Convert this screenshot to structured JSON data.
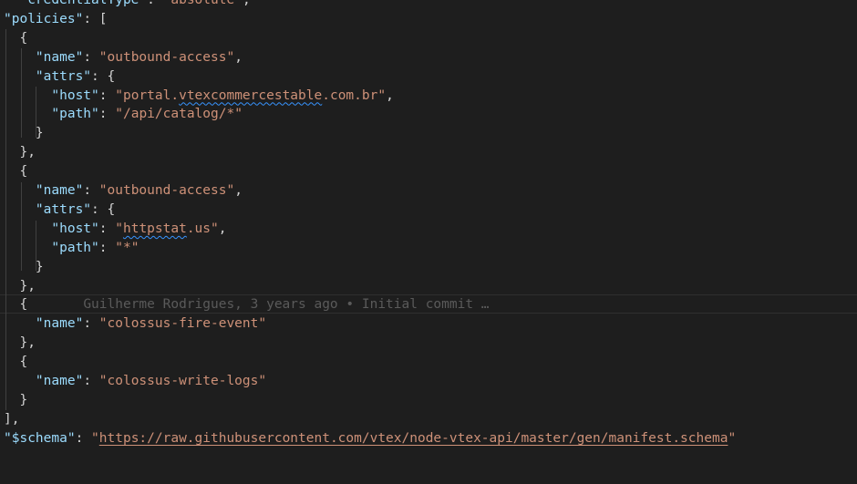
{
  "editor": {
    "lines": [
      {
        "indent": "  ",
        "key": "\"credentialType\"",
        "colon": ": ",
        "value": "\"absolute\"",
        "tail": ","
      },
      {
        "key": "\"policies\"",
        "tail": ": ["
      },
      {
        "indent": "  ",
        "text": "{"
      },
      {
        "indent": "    ",
        "key": "\"name\"",
        "colon": ": ",
        "value": "\"outbound-access\"",
        "tail": ","
      },
      {
        "indent": "    ",
        "key": "\"attrs\"",
        "tail": ": {"
      },
      {
        "indent": "      ",
        "key": "\"host\"",
        "colon": ": ",
        "value_pre": "\"portal.",
        "value_squiggle": "vtexcommercestable",
        "value_post": ".com.br\"",
        "tail": ","
      },
      {
        "indent": "      ",
        "key": "\"path\"",
        "colon": ": ",
        "value": "\"/api/catalog/*\""
      },
      {
        "indent": "    ",
        "text": "}"
      },
      {
        "indent": "  ",
        "text": "},"
      },
      {
        "indent": "  ",
        "text": "{"
      },
      {
        "indent": "    ",
        "key": "\"name\"",
        "colon": ": ",
        "value": "\"outbound-access\"",
        "tail": ","
      },
      {
        "indent": "    ",
        "key": "\"attrs\"",
        "tail": ": {"
      },
      {
        "indent": "      ",
        "key": "\"host\"",
        "colon": ": ",
        "value_pre": "\"",
        "value_squiggle": "httpstat",
        "value_post": ".us\"",
        "tail": ","
      },
      {
        "indent": "      ",
        "key": "\"path\"",
        "colon": ": ",
        "value": "\"*\""
      },
      {
        "indent": "    ",
        "text": "}"
      },
      {
        "indent": "  ",
        "text": "},"
      },
      {
        "indent": "  ",
        "text": "{",
        "blame": "Guilherme Rodrigues, 3 years ago • Initial commit …"
      },
      {
        "indent": "    ",
        "key": "\"name\"",
        "colon": ": ",
        "value": "\"colossus-fire-event\""
      },
      {
        "indent": "  ",
        "text": "},"
      },
      {
        "indent": "  ",
        "text": "{"
      },
      {
        "indent": "    ",
        "key": "\"name\"",
        "colon": ": ",
        "value": "\"colossus-write-logs\""
      },
      {
        "indent": "  ",
        "text": "}"
      },
      {
        "text": "],"
      },
      {
        "key": "\"$schema\"",
        "colon": ": ",
        "value_pre": "\"",
        "value_link": "https://raw.githubusercontent.com/vtex/node-vtex-api/master/gen/manifest.schema",
        "value_post": "\""
      }
    ]
  },
  "colors": {
    "background": "#1e1e1e",
    "key": "#9cdcfe",
    "string": "#ce9178",
    "punctuation": "#d4d4d4",
    "blame": "#5a5a5a",
    "squiggle": "#3794ff"
  }
}
